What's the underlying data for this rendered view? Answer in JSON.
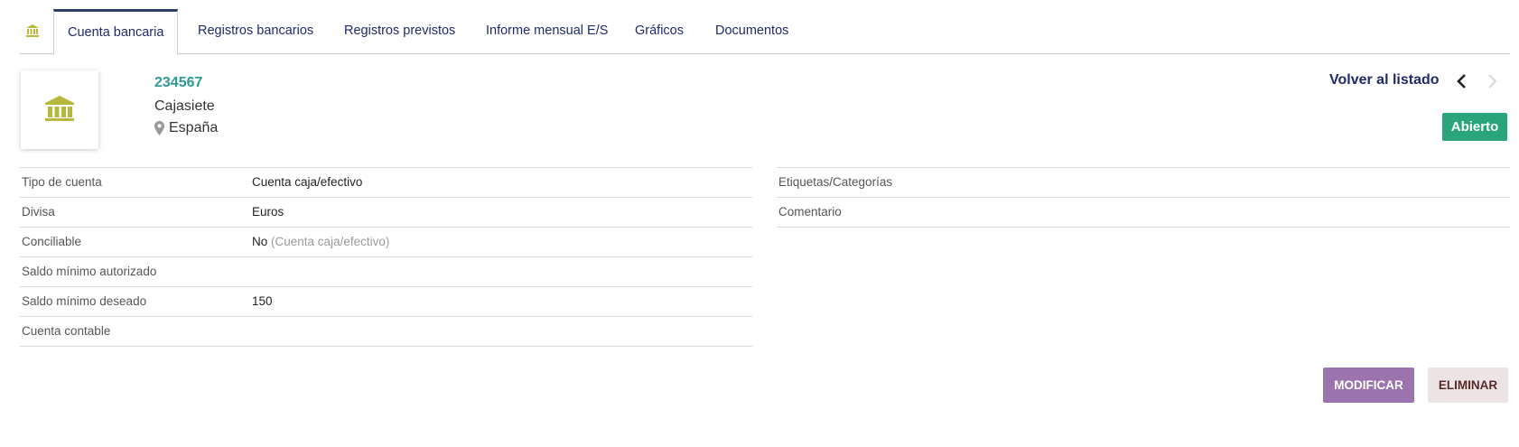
{
  "tabs": {
    "home_icon": "bank-icon",
    "items": [
      {
        "label": "Cuenta bancaria",
        "active": true
      },
      {
        "label": "Registros bancarios"
      },
      {
        "label": "Registros previstos"
      },
      {
        "label": "Informe mensual E/S"
      },
      {
        "label": "Gráficos"
      },
      {
        "label": "Documentos"
      }
    ]
  },
  "account": {
    "number": "234567",
    "bank": "Cajasiete",
    "country": "España",
    "logo_icon": "bank-icon"
  },
  "header": {
    "back_label": "Volver al listado",
    "prev_icon": "chevron-left-icon",
    "next_icon": "chevron-right-icon",
    "status": "Abierto"
  },
  "details_left": [
    {
      "label": "Tipo de cuenta",
      "value": "Cuenta caja/efectivo",
      "note": ""
    },
    {
      "label": "Divisa",
      "value": "Euros",
      "note": ""
    },
    {
      "label": "Conciliable",
      "value": "No",
      "note": "(Cuenta caja/efectivo)"
    },
    {
      "label": "Saldo mínimo autorizado",
      "value": "",
      "note": ""
    },
    {
      "label": "Saldo mínimo deseado",
      "value": "150",
      "note": ""
    },
    {
      "label": "Cuenta contable",
      "value": "",
      "note": ""
    }
  ],
  "details_right": [
    {
      "label": "Etiquetas/Categorías"
    },
    {
      "label": "Comentario"
    }
  ],
  "actions": {
    "modify_label": "MODIFICAR",
    "delete_label": "ELIMINAR"
  },
  "colors": {
    "tab_text": "#1f2a6b",
    "account_number": "#2b9a95",
    "bank_icon": "#b5b83a",
    "status_badge": "#2aa47a",
    "modify_button": "#9b74ad",
    "delete_button": "#ece4e2"
  }
}
